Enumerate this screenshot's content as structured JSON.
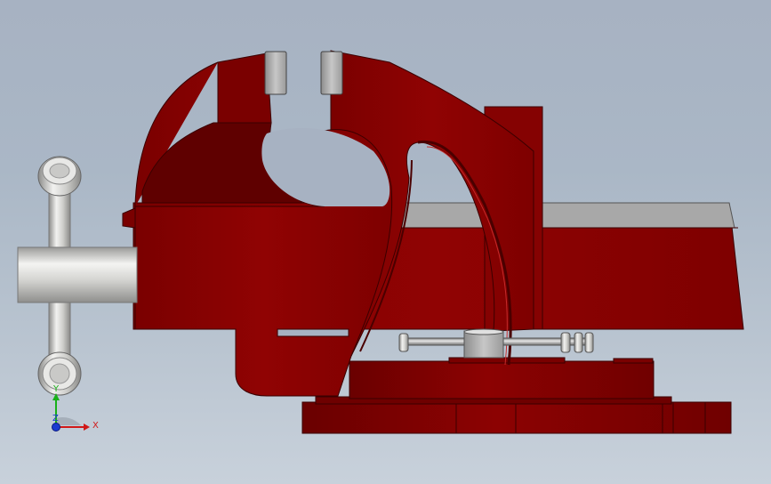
{
  "viewport": {
    "background_top": "#a7b2c2",
    "background_bottom": "#c8d1db"
  },
  "model": {
    "body_color": "#8a0000",
    "body_dark": "#5c0000",
    "steel_color": "#b9b9b9",
    "handle_color": "#d7d7d5"
  },
  "triad": {
    "x_label": "X",
    "y_label": "Y",
    "z_label": "Z",
    "x_color": "#d01818",
    "y_color": "#18b018",
    "z_color": "#1a3ad0"
  }
}
